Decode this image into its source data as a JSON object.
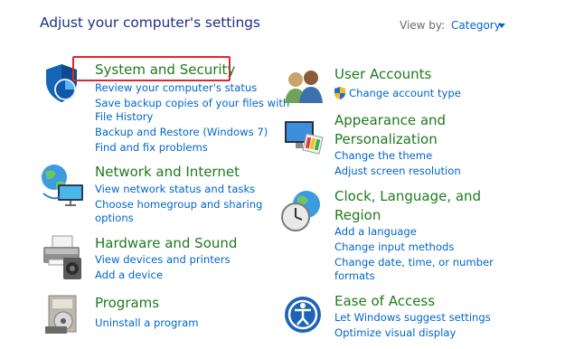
{
  "page": {
    "heading": "Adjust your computer's settings",
    "view_by_label": "View by:",
    "view_by_value": "Category"
  },
  "left": [
    {
      "title": "System and Security",
      "links": [
        "Review your computer's status",
        "Save backup copies of your files with",
        "File History",
        "Backup and Restore (Windows 7)",
        "Find and fix problems"
      ]
    },
    {
      "title": "Network and Internet",
      "links": [
        "View network status and tasks",
        "Choose homegroup and sharing",
        "options"
      ]
    },
    {
      "title": "Hardware and Sound",
      "links": [
        "View devices and printers",
        "Add a device"
      ]
    },
    {
      "title": "Programs",
      "links": [
        "Uninstall a program"
      ]
    }
  ],
  "right": [
    {
      "title": "User Accounts",
      "links": [
        "Change account type"
      ]
    },
    {
      "title_lines": [
        "Appearance and",
        "Personalization"
      ],
      "links": [
        "Change the theme",
        "Adjust screen resolution"
      ]
    },
    {
      "title_lines": [
        "Clock, Language, and",
        "Region"
      ],
      "links": [
        "Add a language",
        "Change input methods",
        "Change date, time, or number",
        "formats"
      ]
    },
    {
      "title": "Ease of Access",
      "links": [
        "Let Windows suggest settings",
        "Optimize visual display"
      ]
    }
  ],
  "icons": {
    "system_security": "shield-icon",
    "network_internet": "network-globe-icon",
    "hardware_sound": "printer-speaker-icon",
    "programs": "programs-disc-icon",
    "user_accounts": "users-icon",
    "appearance": "monitor-palette-icon",
    "clock_region": "clock-globe-icon",
    "ease_access": "ease-of-access-icon",
    "uac_shield": "uac-shield-icon"
  },
  "colors": {
    "category_title": "#1f7a1f",
    "link": "#0066cc",
    "heading": "#1e3287",
    "highlight_box": "#e0262a"
  }
}
